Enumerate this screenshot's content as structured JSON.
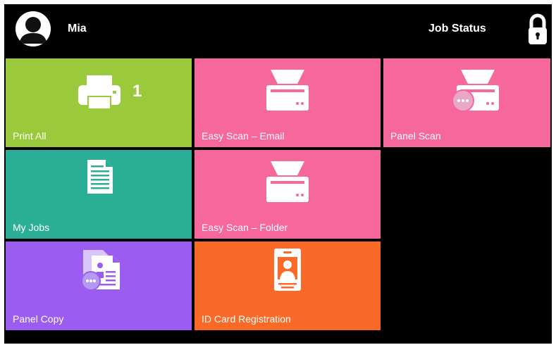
{
  "header": {
    "user_name": "Mia",
    "job_status_label": "Job Status",
    "avatar_icon": "user-avatar-icon",
    "lock_icon": "lock-icon"
  },
  "tiles": [
    {
      "id": "print-all",
      "label": "Print All",
      "icon": "printer-icon",
      "badge": "1",
      "color": "#9ACA3C"
    },
    {
      "id": "easy-scan-email",
      "label": "Easy Scan – Email",
      "icon": "scanner-icon",
      "color": "#F6679B"
    },
    {
      "id": "panel-scan",
      "label": "Panel Scan",
      "icon": "scanner-panel-icon",
      "color": "#F6679B"
    },
    {
      "id": "my-jobs",
      "label": "My Jobs",
      "icon": "document-icon",
      "color": "#2AAE96"
    },
    {
      "id": "easy-scan-folder",
      "label": "Easy Scan – Folder",
      "icon": "scanner-icon",
      "color": "#F6679B"
    },
    {
      "id": "panel-copy",
      "label": "Panel Copy",
      "icon": "copy-icon",
      "color": "#9B5CF0"
    },
    {
      "id": "id-card-registration",
      "label": "ID Card Registration",
      "icon": "id-card-icon",
      "color": "#F96A28"
    }
  ]
}
